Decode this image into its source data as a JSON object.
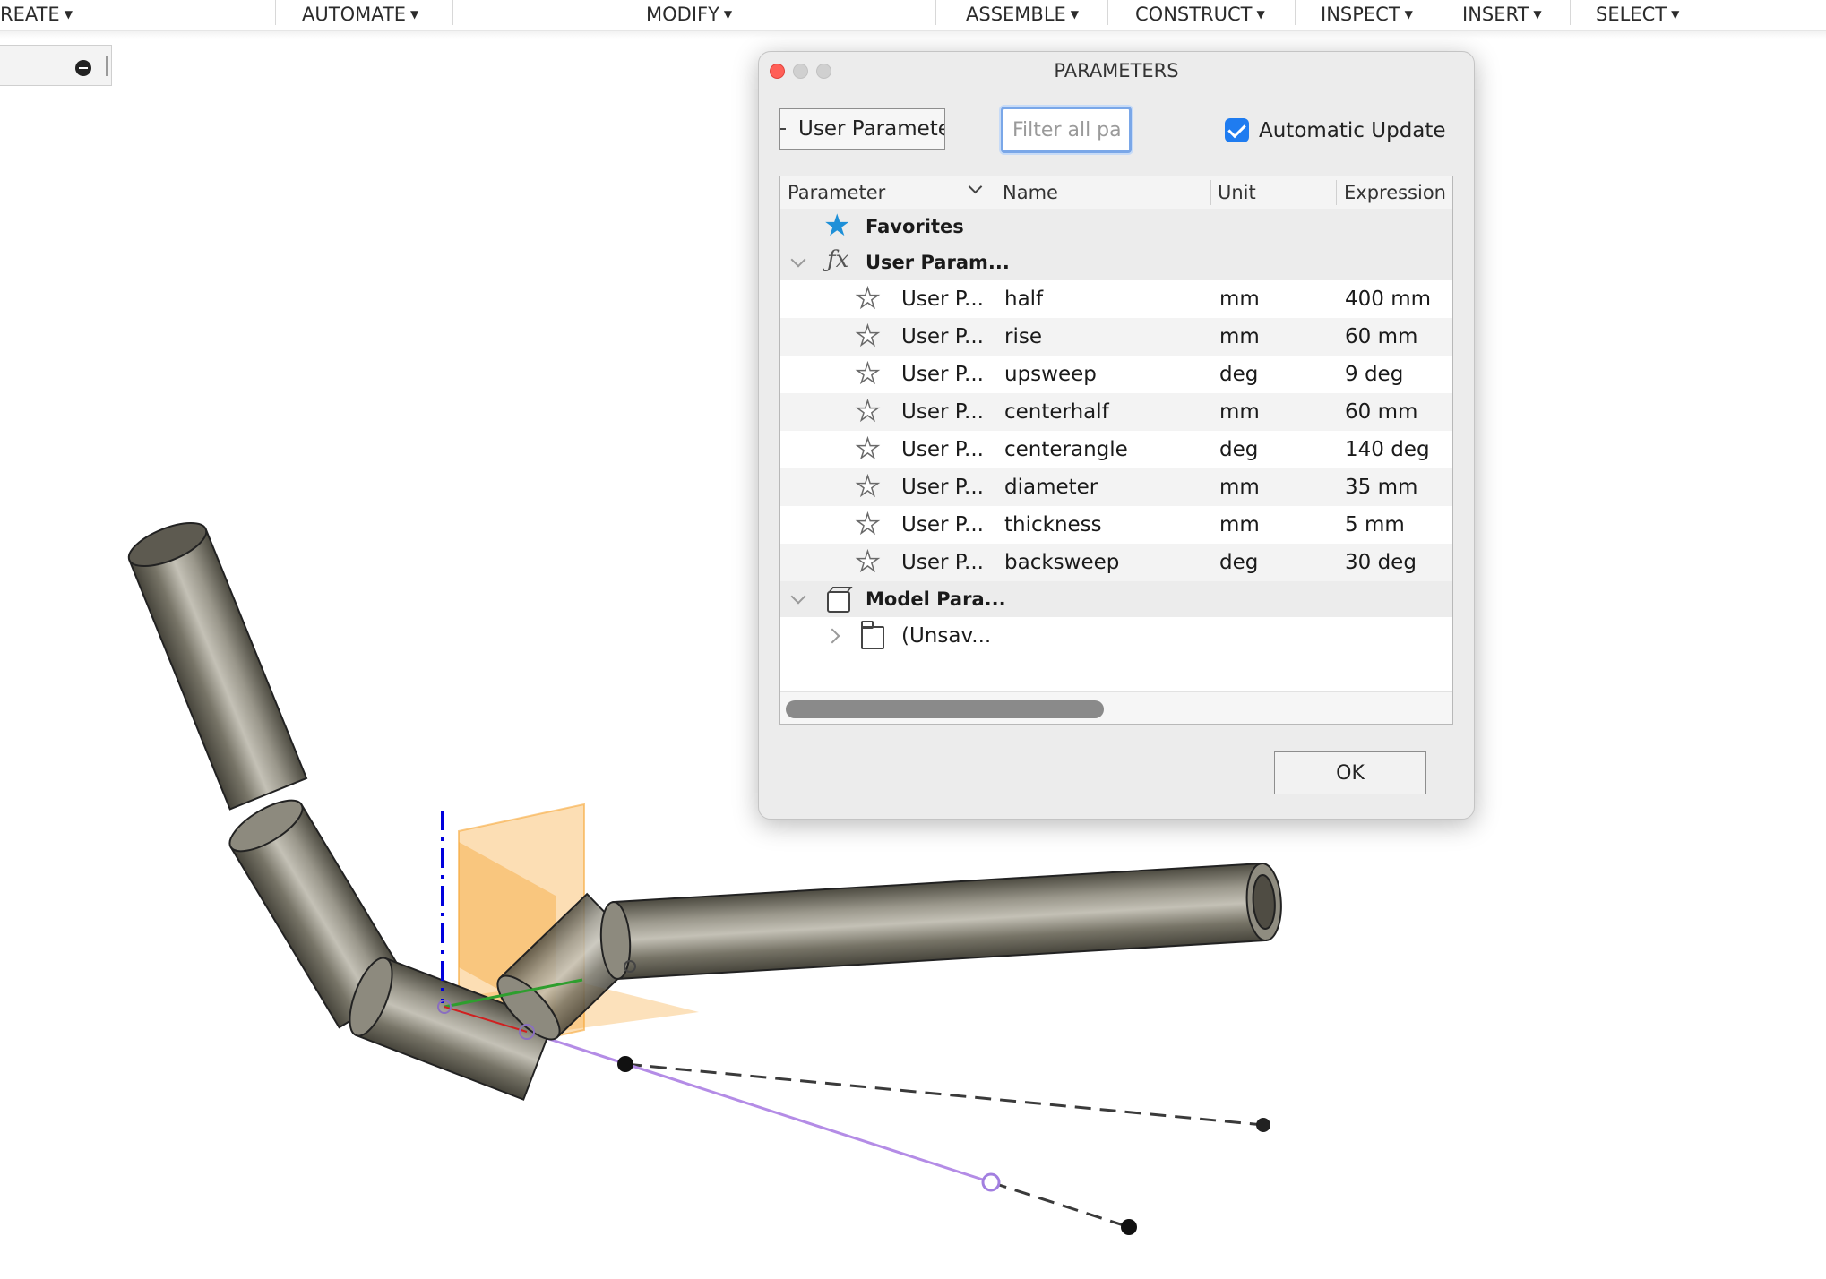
{
  "toolbar": {
    "items": [
      {
        "label": "REATE"
      },
      {
        "label": "AUTOMATE"
      },
      {
        "label": "MODIFY"
      },
      {
        "label": "ASSEMBLE"
      },
      {
        "label": "CONSTRUCT"
      },
      {
        "label": "INSPECT"
      },
      {
        "label": "INSERT"
      },
      {
        "label": "SELECT"
      }
    ],
    "caret": "▼"
  },
  "dialog": {
    "title": "PARAMETERS",
    "category_button": "User Parameters",
    "filter_placeholder": "Filter all par...",
    "auto_update_label": "Automatic Update",
    "auto_update_checked": true,
    "ok_label": "OK"
  },
  "table": {
    "columns": {
      "parameter": "Parameter",
      "name": "Name",
      "unit": "Unit",
      "expression": "Expression"
    },
    "groups": {
      "favorites": "Favorites",
      "user": "User Param...",
      "model": "Model Para...",
      "unsaved": "(Unsav..."
    },
    "rows": [
      {
        "parameter": "User P...",
        "name": "half",
        "unit": "mm",
        "expression": "400 mm"
      },
      {
        "parameter": "User P...",
        "name": "rise",
        "unit": "mm",
        "expression": "60 mm"
      },
      {
        "parameter": "User P...",
        "name": "upsweep",
        "unit": "deg",
        "expression": "9 deg"
      },
      {
        "parameter": "User P...",
        "name": "centerhalf",
        "unit": "mm",
        "expression": "60 mm"
      },
      {
        "parameter": "User P...",
        "name": "centerangle",
        "unit": "deg",
        "expression": "140 deg"
      },
      {
        "parameter": "User P...",
        "name": "diameter",
        "unit": "mm",
        "expression": "35 mm"
      },
      {
        "parameter": "User P...",
        "name": "thickness",
        "unit": "mm",
        "expression": "5 mm"
      },
      {
        "parameter": "User P...",
        "name": "backsweep",
        "unit": "deg",
        "expression": "30 deg"
      }
    ]
  },
  "colors": {
    "accent": "#1f7cf0",
    "favorite_star": "#1e90d8",
    "pipe": "#6f6c60",
    "plane": "#f6a93b",
    "sketch_line": "#b48ce6",
    "axis_blue": "#0000dd",
    "close_button": "#ff5f57"
  }
}
